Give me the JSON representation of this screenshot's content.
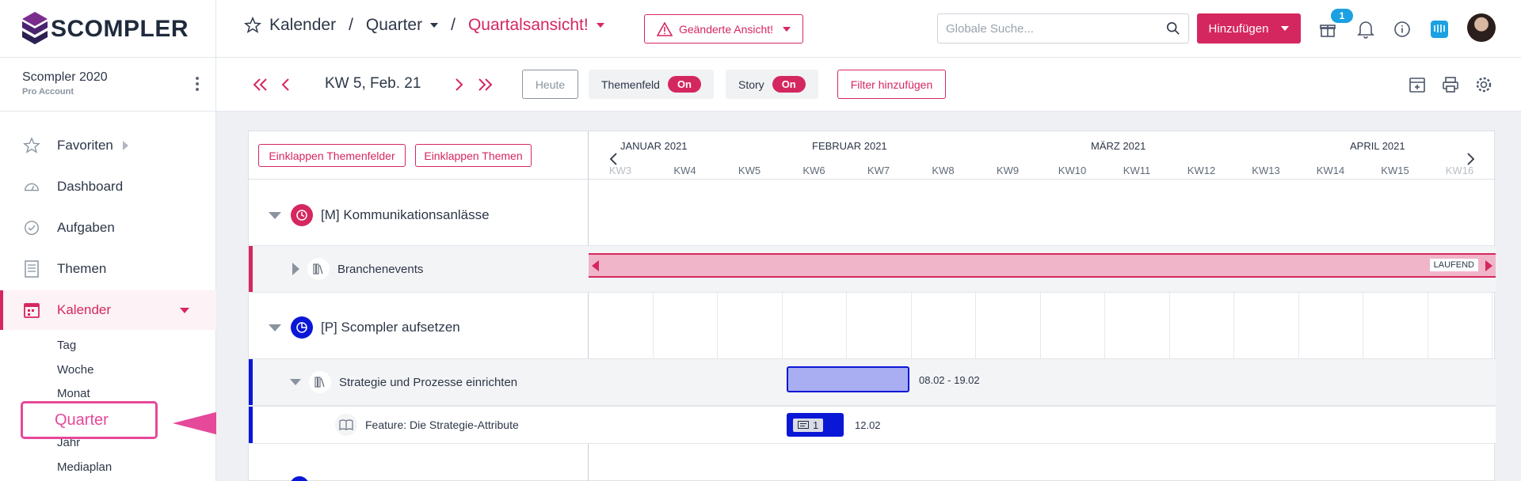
{
  "brand": {
    "logo_text": "SCOMPLER",
    "accent": "#d5275f",
    "plan_color": "#0b17d6"
  },
  "header": {
    "breadcrumb": [
      "Kalender",
      "Quarter",
      "Quartalsansicht!"
    ],
    "separator": "/",
    "warning_button": "Geänderte Ansicht!",
    "search_placeholder": "Globale Suche...",
    "add_button": "Hinzufügen",
    "notification_badge": "1",
    "icons": [
      "gift-icon",
      "bell-icon",
      "info-icon",
      "intercom-icon",
      "avatar"
    ]
  },
  "sidebar": {
    "account_name": "Scompler 2020",
    "account_sub": "Pro Account",
    "items": [
      {
        "label": "Favoriten",
        "icon": "star-icon"
      },
      {
        "label": "Dashboard",
        "icon": "gauge-icon"
      },
      {
        "label": "Aufgaben",
        "icon": "check-circle-icon"
      },
      {
        "label": "Themen",
        "icon": "document-icon"
      },
      {
        "label": "Kalender",
        "icon": "calendar-icon"
      }
    ],
    "calendar_sub": [
      "Tag",
      "Woche",
      "Monat",
      "Jahr",
      "Mediaplan"
    ],
    "highlighted": "Quarter"
  },
  "toolbar": {
    "week_label": "KW 5, Feb. 21",
    "today_button": "Heute",
    "toggle1_label": "Themenfeld",
    "toggle1_value": "On",
    "toggle2_label": "Story",
    "toggle2_value": "On",
    "filter_button": "Filter hinzufügen"
  },
  "panel": {
    "collapse_fields": "Einklappen Themenfelder",
    "collapse_topics": "Einklappen Themen",
    "months": [
      "JANUAR 2021",
      "FEBRUAR 2021",
      "MÄRZ 2021",
      "APRIL 2021"
    ],
    "weeks": [
      "KW3",
      "KW4",
      "KW5",
      "KW6",
      "KW7",
      "KW8",
      "KW9",
      "KW10",
      "KW11",
      "KW12",
      "KW13",
      "KW14",
      "KW15",
      "KW16"
    ],
    "groups": [
      {
        "title": "[M] Kommunikationsanlässe",
        "color": "#d5275f",
        "rows": [
          {
            "title": "Branchenevents",
            "status": "LAUFEND"
          }
        ]
      },
      {
        "title": "[P] Scompler aufsetzen",
        "color": "#0b17d6",
        "rows": [
          {
            "title": "Strategie und Prozesse einrichten",
            "range": "08.02 - 19.02"
          },
          {
            "title": "Feature: Die Strategie-Attribute",
            "count": "1",
            "date": "12.02"
          }
        ]
      }
    ]
  }
}
